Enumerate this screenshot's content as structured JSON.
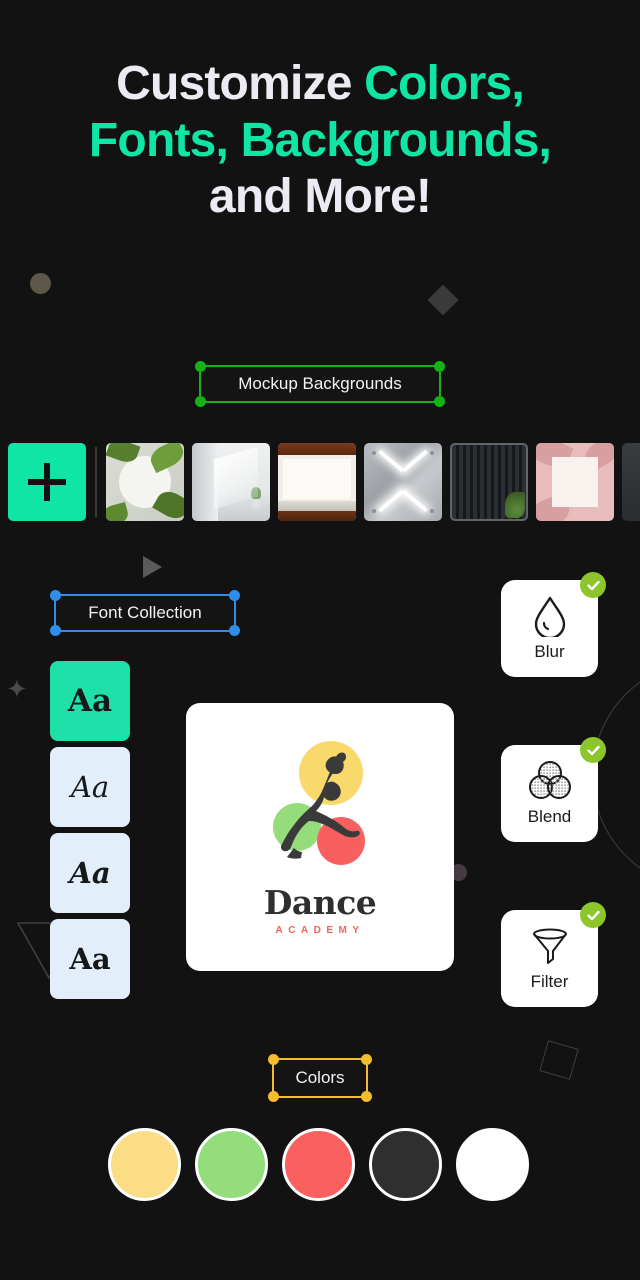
{
  "heading": {
    "line1_a": "Customize ",
    "line1_b": "Colors,",
    "line2": "Fonts, Backgrounds,",
    "line3": "and More!",
    "accent_color": "#0fe6a6",
    "base_color": "#eceaf3"
  },
  "sections": {
    "backgrounds": {
      "label": "Mockup Backgrounds",
      "selection_color": "#12b312",
      "add_button_label": "+",
      "thumbnails": [
        {
          "name": "white-plate-leaves"
        },
        {
          "name": "white-room-interior"
        },
        {
          "name": "wood-frame-wall"
        },
        {
          "name": "metal-panel-lights"
        },
        {
          "name": "dark-slat-wall"
        },
        {
          "name": "pink-palm-frame"
        },
        {
          "name": "dark-partial"
        }
      ]
    },
    "fonts": {
      "label": "Font Collection",
      "selection_color": "#2f8fe8",
      "tiles": [
        {
          "sample": "Aa",
          "selected": true
        },
        {
          "sample": "Aa",
          "selected": false
        },
        {
          "sample": "Aa",
          "selected": false
        },
        {
          "sample": "Aa",
          "selected": false
        }
      ]
    },
    "colors": {
      "label": "Colors",
      "selection_color": "#f5bd2e",
      "swatches": [
        {
          "name": "yellow",
          "hex": "#fbdd85"
        },
        {
          "name": "green",
          "hex": "#93dd7d"
        },
        {
          "name": "red",
          "hex": "#f9605e"
        },
        {
          "name": "dark",
          "hex": "#2f2f2f"
        },
        {
          "name": "white",
          "hex": "#ffffff"
        }
      ]
    },
    "effects": [
      {
        "label": "Blur",
        "icon": "droplet-icon",
        "checked": true
      },
      {
        "label": "Blend",
        "icon": "venn-circles-icon",
        "checked": true
      },
      {
        "label": "Filter",
        "icon": "funnel-icon",
        "checked": true
      }
    ]
  },
  "logo": {
    "title": "Dance",
    "subtitle": "ACADEMY",
    "title_color": "#2f2f2f",
    "subtitle_color": "#f2635f",
    "circles": [
      {
        "name": "yellow",
        "hex": "#f9d96b"
      },
      {
        "name": "green",
        "hex": "#95dd7a"
      },
      {
        "name": "red",
        "hex": "#f7605f"
      }
    ]
  }
}
